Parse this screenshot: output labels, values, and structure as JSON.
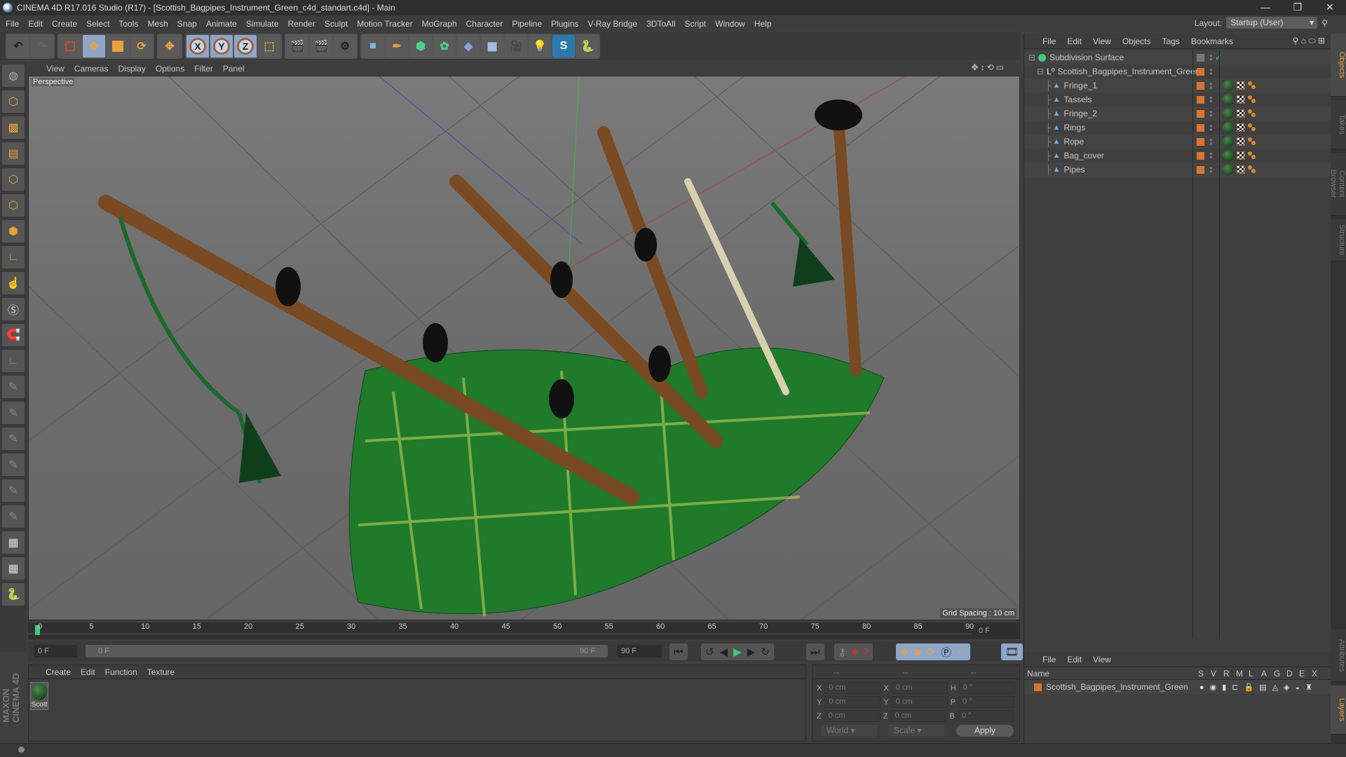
{
  "window": {
    "title": "CINEMA 4D R17.016 Studio (R17) - [Scottish_Bagpipes_Instrument_Green_c4d_standart.c4d] - Main",
    "minimize": "—",
    "restore": "❐",
    "close": "✕"
  },
  "menu": [
    "File",
    "Edit",
    "Create",
    "Select",
    "Tools",
    "Mesh",
    "Snap",
    "Animate",
    "Simulate",
    "Render",
    "Sculpt",
    "Motion Tracker",
    "MoGraph",
    "Character",
    "Pipeline",
    "Plugins",
    "V-Ray Bridge",
    "3DToAll",
    "Script",
    "Window",
    "Help"
  ],
  "layout": {
    "label": "Layout:",
    "value": "Startup (User)"
  },
  "toolbar": {
    "x": "X",
    "y": "Y",
    "z": "Z"
  },
  "viewport": {
    "menu": [
      "View",
      "Cameras",
      "Display",
      "Options",
      "Filter",
      "Panel"
    ],
    "label": "Perspective",
    "grid_spacing": "Grid Spacing : 10 cm"
  },
  "timeline": {
    "ticks": [
      "0",
      "5",
      "10",
      "15",
      "20",
      "25",
      "30",
      "35",
      "40",
      "45",
      "50",
      "55",
      "60",
      "65",
      "70",
      "75",
      "80",
      "85",
      "90"
    ],
    "current_frame": "0 F",
    "start": "0 F",
    "range_start": "0 F",
    "range_end": "90 F",
    "end": "90 F"
  },
  "material_manager": {
    "menu": [
      "Create",
      "Edit",
      "Function",
      "Texture"
    ],
    "materials": [
      {
        "name": "Scott"
      }
    ]
  },
  "coordinates": {
    "headers": [
      "--",
      "--",
      "--"
    ],
    "rows": [
      {
        "a": "X",
        "av": "0 cm",
        "b": "X",
        "bv": "0 cm",
        "c": "H",
        "cv": "0 °"
      },
      {
        "a": "Y",
        "av": "0 cm",
        "b": "Y",
        "bv": "0 cm",
        "c": "P",
        "cv": "0 °"
      },
      {
        "a": "Z",
        "av": "0 cm",
        "b": "Z",
        "bv": "0 cm",
        "c": "B",
        "cv": "0 °"
      }
    ],
    "space": "World",
    "mode": "Scale",
    "apply": "Apply"
  },
  "object_manager": {
    "menu": [
      "File",
      "Edit",
      "View",
      "Objects",
      "Tags",
      "Bookmarks"
    ],
    "objects": [
      {
        "name": "Subdivision Surface",
        "level": 0
      },
      {
        "name": "Scottish_Bagpipes_Instrument_Green",
        "level": 1
      },
      {
        "name": "Fringe_1",
        "level": 2
      },
      {
        "name": "Tassels",
        "level": 2
      },
      {
        "name": "Fringe_2",
        "level": 2
      },
      {
        "name": "Rings",
        "level": 2
      },
      {
        "name": "Rope",
        "level": 2
      },
      {
        "name": "Bag_cover",
        "level": 2
      },
      {
        "name": "Pipes",
        "level": 2
      }
    ]
  },
  "layers": {
    "menu": [
      "File",
      "Edit",
      "View"
    ],
    "columns": [
      "Name",
      "S",
      "V",
      "R",
      "M",
      "L",
      "A",
      "G",
      "D",
      "E",
      "X"
    ],
    "rows": [
      {
        "name": "Scottish_Bagpipes_Instrument_Green",
        "color": "#d9752e"
      }
    ]
  },
  "side_tabs": [
    "Objects",
    "Takes",
    "Content Browser",
    "Structure",
    "Attributes",
    "Layers"
  ],
  "brand": "MAXON CINEMA 4D",
  "colors": {
    "accent": "#8ea7c9",
    "layer": "#d9752e",
    "active_tab": "#e0a040"
  }
}
